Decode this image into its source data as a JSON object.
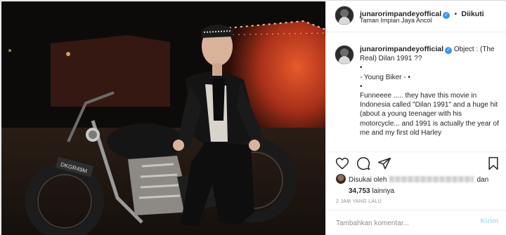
{
  "header": {
    "username": "junarorimpandeyoffical",
    "verified_mark": "✓",
    "separator": "•",
    "follow_state": "Diikuti",
    "location": "Taman Impian Jaya Ancol"
  },
  "caption": {
    "username": "junarorimpandeyofficial",
    "verified_mark": "✓",
    "lines": [
      "Object : (The Real) Dilan 1991 ??",
      "•",
      "- Young Biker - •",
      "•",
      "Funneeee ..... they have this movie in Indonesia called \"Dilan 1991\" and a huge hit (about a young teenager with his motorcycle... and 1991 is actually the year of me and my first old Harley"
    ]
  },
  "actions": {
    "like_icon": "heart-icon",
    "comment_icon": "comment-icon",
    "share_icon": "share-icon",
    "save_icon": "bookmark-icon"
  },
  "likes": {
    "prefix": "Disukai oleh",
    "and": "dan",
    "count": "34,753",
    "suffix": "lainnya"
  },
  "timestamp": "2 JAM YANG LALU",
  "comment": {
    "placeholder": "Tambahkan komentar...",
    "post_label": "Kirim"
  },
  "colors": {
    "verified": "#3897f0",
    "post_disabled": "#b2dffc",
    "muted": "#8e8e8e"
  }
}
